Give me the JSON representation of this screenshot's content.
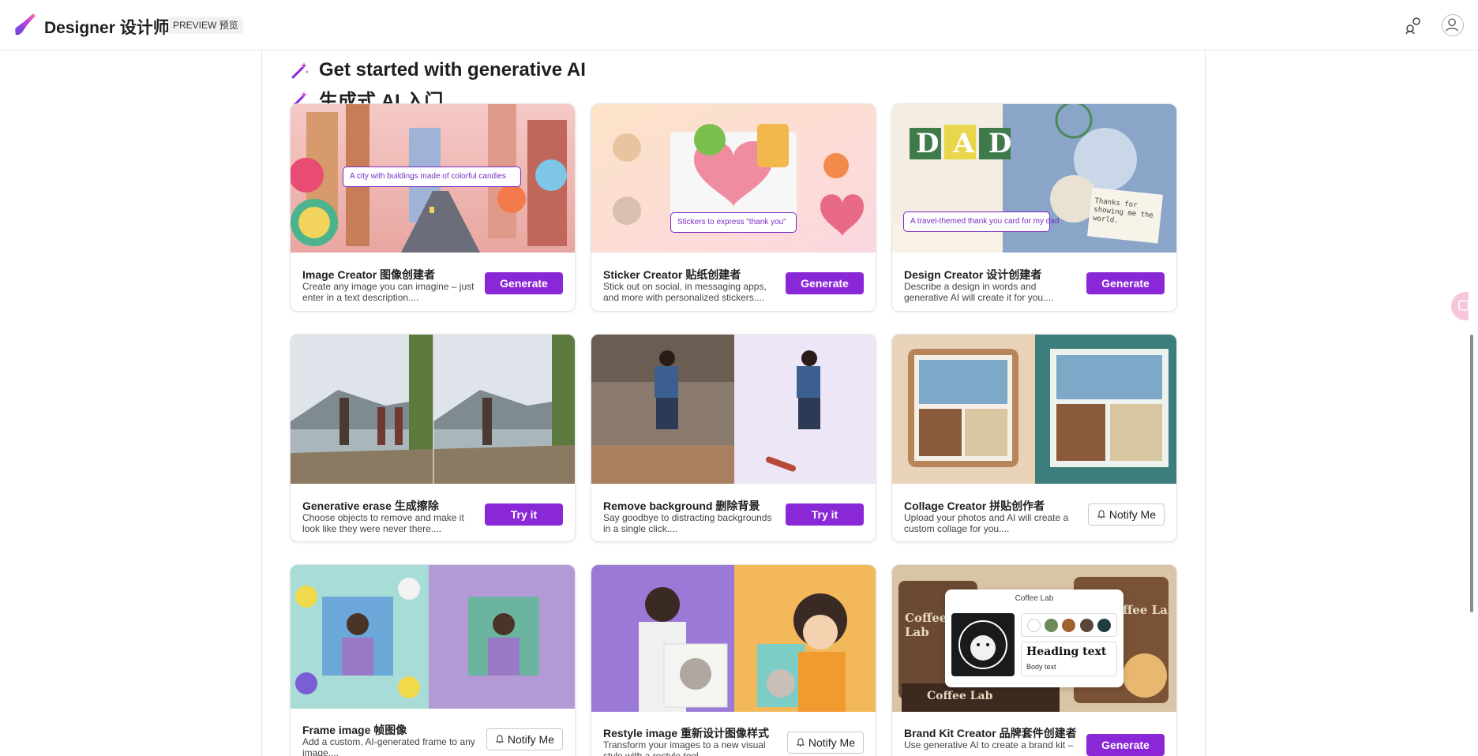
{
  "header": {
    "app_title": "Designer 设计师",
    "preview_badge": "PREVIEW 预览"
  },
  "main": {
    "heading": "Get started with generative AI",
    "heading_cn": "生成式 AI 入门",
    "cards": [
      {
        "title": "Image Creator 图像创建者",
        "desc": "Create any image you can imagine – just enter in a text description....",
        "button": "Generate",
        "prompt": "A city with buildings made of colorful candies"
      },
      {
        "title": "Sticker Creator 贴纸创建者",
        "desc": "Stick out on social, in messaging apps, and more with personalized stickers....",
        "button": "Generate",
        "prompt": "Stickers to express \"thank you\""
      },
      {
        "title": "Design Creator 设计创建者",
        "desc": "Describe a design in words and generative AI will create it for you....",
        "button": "Generate",
        "prompt": "A travel-themed thank you card for my dad",
        "art_text": "DAD",
        "note_text": "Thanks for showing me the world."
      },
      {
        "title": "Generative erase 生成擦除",
        "desc": "Choose objects to remove and make it look like they were never there....",
        "button": "Try it"
      },
      {
        "title": "Remove background 删除背景",
        "desc": "Say goodbye to distracting backgrounds in a single click....",
        "button": "Try it"
      },
      {
        "title": "Collage Creator 拼贴创作者",
        "desc": "Upload your photos and AI will create a custom collage for you....",
        "button": "Notify Me"
      },
      {
        "title": "Frame image 帧图像",
        "desc": "Add a custom, AI-generated frame to any image....",
        "button": "Notify Me"
      },
      {
        "title": "Restyle image 重新设计图像样式",
        "desc": "Transform your images to a new visual style with a restyle tool....",
        "button": "Notify Me"
      },
      {
        "title": "Brand Kit Creator 品牌套件创建者",
        "desc": "Use generative AI to create a brand kit – ...",
        "button": "Generate",
        "brand_name": "Coffee Lab",
        "heading_text": "Heading text",
        "body_text": "Body text"
      }
    ]
  },
  "colors": {
    "accent": "#8a27d6",
    "border": "#e5e5e5",
    "brand_swatches": [
      "#ffffff",
      "#6e8a5a",
      "#a0612e",
      "#5a4636",
      "#1e3d3f"
    ]
  },
  "icons": {
    "logo": "designer-logo-icon",
    "share": "share-icon",
    "profile": "profile-icon",
    "wand": "magic-wand-icon",
    "bell": "bell-icon"
  }
}
